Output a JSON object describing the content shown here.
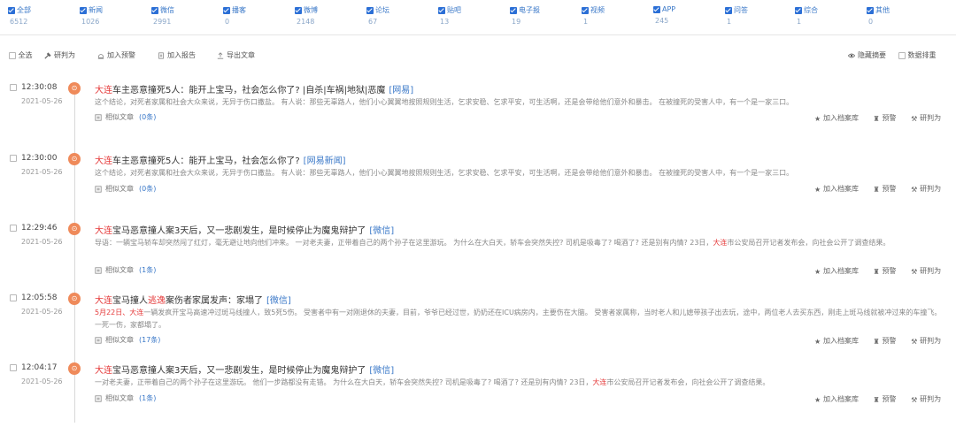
{
  "categories": [
    {
      "name": "全部",
      "count": "6512"
    },
    {
      "name": "新闻",
      "count": "1026"
    },
    {
      "name": "微信",
      "count": "2991"
    },
    {
      "name": "播客",
      "count": "0"
    },
    {
      "name": "微博",
      "count": "2148"
    },
    {
      "name": "论坛",
      "count": "67"
    },
    {
      "name": "贴吧",
      "count": "13"
    },
    {
      "name": "电子报",
      "count": "19"
    },
    {
      "name": "视频",
      "count": "1"
    },
    {
      "name": "APP",
      "count": "245"
    },
    {
      "name": "问答",
      "count": "1"
    },
    {
      "name": "综合",
      "count": "1"
    },
    {
      "name": "其他",
      "count": "0"
    }
  ],
  "toolbar": {
    "select_all": "全选",
    "judge": "研判为",
    "add_alert": "加入预警",
    "add_report": "加入报告",
    "export": "导出文章",
    "hide_summary": "隐藏摘要",
    "data_sort": "数据排重"
  },
  "rows": [
    {
      "time": "12:30:08",
      "date": "2021-05-26",
      "title_kw": "大连",
      "title_rest": "车主恶意撞死5人：能开上宝马，社会怎么你了? |自杀|车祸|地狱|恶魔",
      "source": "[网易]",
      "summary": "这个结论，对死者家属和社会大众来说，无异于伤口撒盐。 有人说：那些无辜路人，他们小心翼翼地按照规则生活，乞求安稳、乞求平安，可生活啊，还是会带给他们意外和暴击。 在被撞死的受害人中，有一个是一家三口。",
      "similar_label": "相似文章",
      "similar_count": "(0条)",
      "act1": "加入档案库",
      "act2": "预警",
      "act3": "研判为"
    },
    {
      "time": "12:30:00",
      "date": "2021-05-26",
      "title_kw": "大连",
      "title_rest": "车主恶意撞死5人：能开上宝马，社会怎么你了?",
      "source": "[网易新闻]",
      "summary": "这个结论，对死者家属和社会大众来说，无异于伤口撒盐。 有人说：那些无辜路人，他们小心翼翼地按照规则生活，乞求安稳、乞求平安，可生活啊，还是会带给他们意外和暴击。 在被撞死的受害人中，有一个是一家三口。",
      "similar_label": "相似文章",
      "similar_count": "(0条)",
      "act1": "加入档案库",
      "act2": "预警",
      "act3": "研判为"
    },
    {
      "time": "12:29:46",
      "date": "2021-05-26",
      "title_kw": "大连",
      "title_rest": "宝马恶意撞人案3天后，又一悲剧发生，是时候停止为魔鬼辩护了",
      "source": "[微信]",
      "summary_pre": "导语：一辆宝马轿车却突然闯了红灯，毫无避让地向他们冲来。 一对老夫妻，正带着自己的两个孙子在这里游玩。 为什么在大白天，轿车会突然失控? 司机是吸毒了? 喝酒了? 还是别有内情? 23日，",
      "summary_kw": "大连",
      "summary_post": "市公安局召开记者发布会，向社会公开了调查结果。",
      "similar_label": "相似文章",
      "similar_count": "(1条)",
      "act1": "加入档案库",
      "act2": "预警",
      "act3": "研判为"
    },
    {
      "time": "12:05:58",
      "date": "2021-05-26",
      "title_kw": "大连",
      "title_mid": "宝马撞人",
      "title_kw2": "逃逸",
      "title_rest": "案伤者家属发声：家塌了",
      "source": "[微信]",
      "summary_kw": "5月22日、大连",
      "summary_post": "一辆发疯开宝马高速冲过斑马线撞人，致5死5伤。 受害者中有一对刚退休的夫妻，目前，爷爷已经过世，奶奶还在ICU病房内，主要伤在大脑。 受害者家属称，当时老人和儿媳带孩子出去玩，途中，两位老人去买东西，刚走上斑马线就被冲过来的车撞飞。 一死一伤，家都塌了。",
      "similar_label": "相似文章",
      "similar_count": "(17条)",
      "act1": "加入档案库",
      "act2": "预警",
      "act3": "研判为"
    },
    {
      "time": "12:04:17",
      "date": "2021-05-26",
      "title_kw": "大连",
      "title_rest": "宝马恶意撞人案3天后，又一悲剧发生，是时候停止为魔鬼辩护了",
      "source": "[微信]",
      "summary_pre": "一对老夫妻，正带着自己的两个孙子在这里游玩。 他们一步路都没有走错。 为什么在大白天，轿车会突然失控? 司机是吸毒了? 喝酒了? 还是别有内情? 23日，",
      "summary_kw": "大连",
      "summary_post": "市公安局召开记者发布会，向社会公开了调查结果。",
      "similar_label": "相似文章",
      "similar_count": "(1条)",
      "act1": "加入档案库",
      "act2": "预警",
      "act3": "研判为"
    }
  ],
  "colors": {
    "accent": "#2b6fd6",
    "keyword": "#e53b3b",
    "dot": "#ef8a5a",
    "link": "#3a78c8"
  }
}
